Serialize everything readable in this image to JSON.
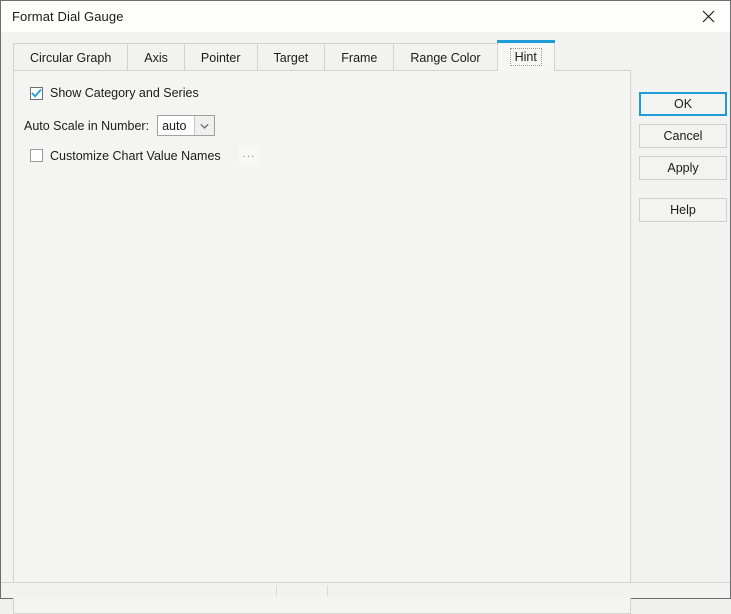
{
  "window": {
    "title": "Format Dial Gauge",
    "close_icon": "close-icon"
  },
  "tabs": [
    {
      "label": "Circular Graph",
      "selected": false
    },
    {
      "label": "Axis",
      "selected": false
    },
    {
      "label": "Pointer",
      "selected": false
    },
    {
      "label": "Target",
      "selected": false
    },
    {
      "label": "Frame",
      "selected": false
    },
    {
      "label": "Range Color",
      "selected": false
    },
    {
      "label": "Hint",
      "selected": true
    }
  ],
  "hint_panel": {
    "show_category_and_series": {
      "label": "Show Category and Series",
      "checked": true
    },
    "auto_scale": {
      "label": "Auto Scale in Number:",
      "value": "auto",
      "options": [
        "auto"
      ],
      "arrow_icon": "chevron-down-icon"
    },
    "customize_chart_value_names": {
      "label": "Customize Chart Value Names",
      "checked": false,
      "browse_label": "..."
    }
  },
  "buttons": {
    "ok": "OK",
    "cancel": "Cancel",
    "apply": "Apply",
    "help": "Help"
  },
  "colors": {
    "accent": "#1f9bd8",
    "checkmark": "#1f9bd8",
    "window_bg": "#f2f2f0",
    "panel_bg": "#f4f4f2",
    "titlebar_bg": "#fdfdfb",
    "border": "#d2d2d0"
  },
  "statusbar": {
    "text": ""
  }
}
